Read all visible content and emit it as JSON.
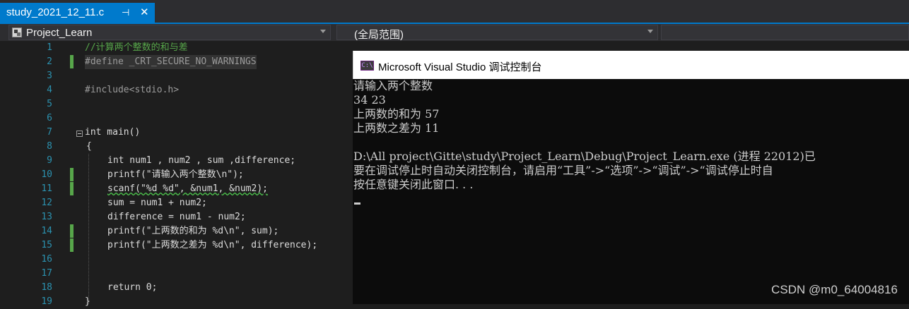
{
  "tab": {
    "title": "study_2021_12_11.c",
    "pin": "⊣",
    "close": "✕"
  },
  "navbar": {
    "project": "Project_Learn",
    "scope": "(全局范围)"
  },
  "editor": {
    "lines": [
      {
        "n": "1",
        "text": "//计算两个整数的和与差"
      },
      {
        "n": "2",
        "text": "#define _CRT_SECURE_NO_WARNINGS"
      },
      {
        "n": "3",
        "text": ""
      },
      {
        "n": "4",
        "text": "#include<stdio.h>"
      },
      {
        "n": "5",
        "text": ""
      },
      {
        "n": "6",
        "text": ""
      },
      {
        "n": "7",
        "text": "int main()"
      },
      {
        "n": "8",
        "text": "{"
      },
      {
        "n": "9",
        "text": "int num1 , num2 , sum ,difference;"
      },
      {
        "n": "10",
        "text": "printf(\"请输入两个整数\\n\");"
      },
      {
        "n": "11",
        "text": "scanf(\"%d %d\", &num1, &num2);"
      },
      {
        "n": "12",
        "text": "sum = num1 + num2;"
      },
      {
        "n": "13",
        "text": "difference = num1 - num2;"
      },
      {
        "n": "14",
        "text": "printf(\"上两数的和为 %d\\n\", sum);"
      },
      {
        "n": "15",
        "text": "printf(\"上两数之差为 %d\\n\", difference);"
      },
      {
        "n": "16",
        "text": ""
      },
      {
        "n": "17",
        "text": ""
      },
      {
        "n": "18",
        "text": "return 0;"
      },
      {
        "n": "19",
        "text": "}"
      }
    ]
  },
  "console": {
    "title": "Microsoft Visual Studio 调试控制台",
    "icon_text": "C:\\",
    "lines": [
      "请输入两个整数",
      "34 23",
      "上两数的和为 57",
      "上两数之差为 11",
      "",
      "D:\\All project\\Gitte\\study\\Project_Learn\\Debug\\Project_Learn.exe (进程 22012)已",
      "要在调试停止时自动关闭控制台，请启用“工具”->“选项”->“调试”->“调试停止时自",
      "按任意键关闭此窗口. . ."
    ]
  },
  "watermark": "CSDN @m0_64004816",
  "colors": {
    "accent": "#007acc",
    "change_bar": "#57a64a",
    "line_number": "#2b91af"
  }
}
